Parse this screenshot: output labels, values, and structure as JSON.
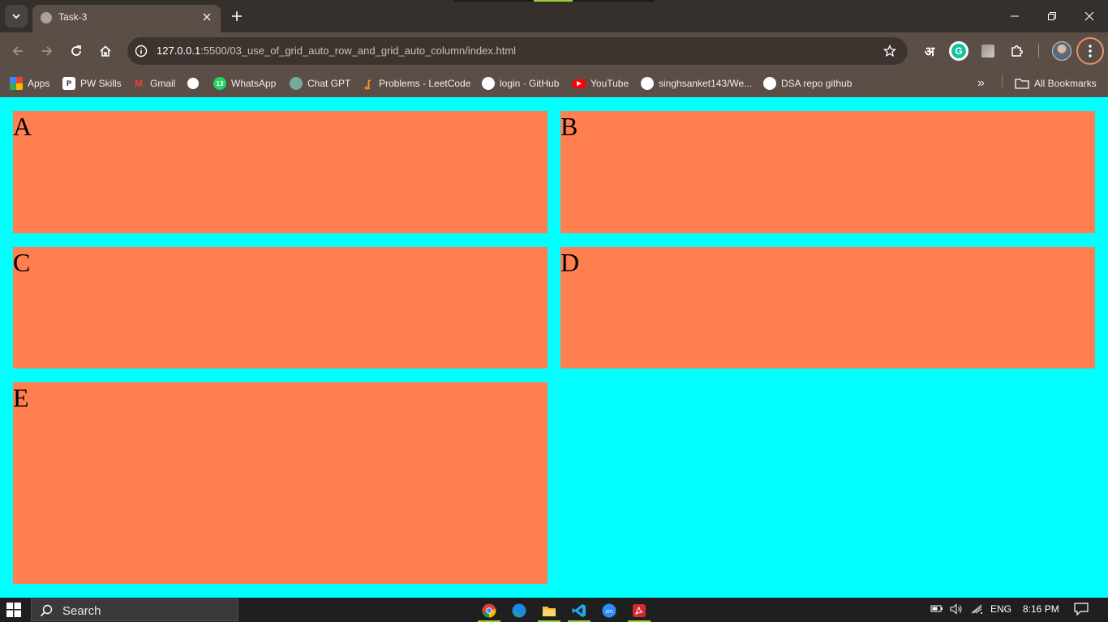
{
  "browser": {
    "tab_title": "Task-3",
    "url_host": "127.0.0.1",
    "url_rest": ":5500/03_use_of_grid_auto_row_and_grid_auto_column/index.html",
    "extension_hindi": "अ",
    "extension_grammarly": "G"
  },
  "bookmarks": {
    "items": [
      {
        "label": "Apps"
      },
      {
        "label": "PW Skills"
      },
      {
        "label": "Gmail"
      },
      {
        "label": ""
      },
      {
        "label": "WhatsApp",
        "badge": "13"
      },
      {
        "label": "Chat GPT"
      },
      {
        "label": "Problems - LeetCode"
      },
      {
        "label": "login · GitHub"
      },
      {
        "label": "YouTube"
      },
      {
        "label": "singhsanket143/We..."
      },
      {
        "label": "DSA repo github"
      }
    ],
    "more": "»",
    "all_bookmarks": "All Bookmarks"
  },
  "page": {
    "background": "#00ffff",
    "item_color": "#ff7f50",
    "cells": [
      "A",
      "B",
      "C",
      "D",
      "E"
    ]
  },
  "taskbar": {
    "search_label": "Search",
    "lang": "ENG",
    "time": "8:16 PM"
  }
}
